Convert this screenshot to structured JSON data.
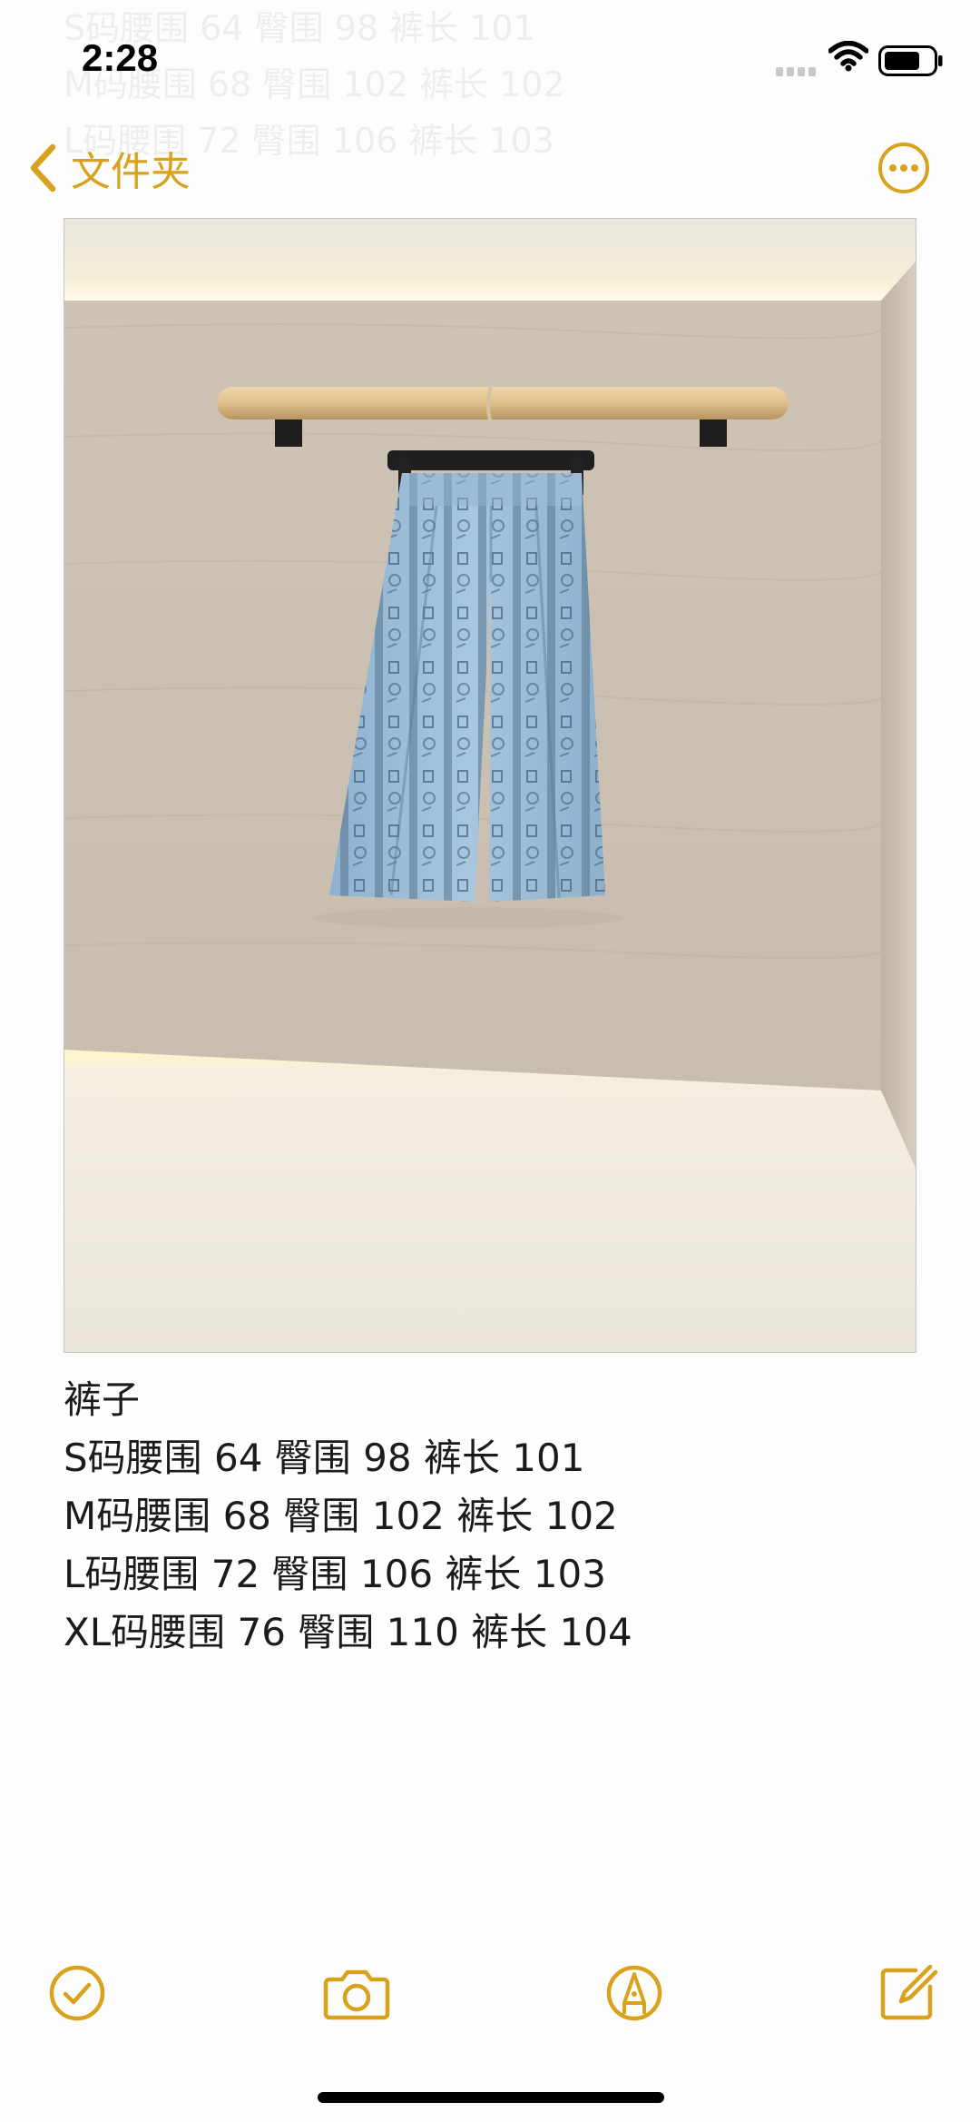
{
  "status_bar": {
    "time": "2:28",
    "icons": [
      "cellular-signal-icon",
      "wifi-icon",
      "battery-icon"
    ]
  },
  "nav": {
    "back_label": "文件夹",
    "back_icon": "chevron-left-icon",
    "more_icon": "ellipsis-circle-icon"
  },
  "note": {
    "image": "photo of light blue printed wide-leg trousers hanging on a wooden rail",
    "lines": [
      "裤子",
      "S码腰围 64 臀围 98 裤长 101",
      "M码腰围 68 臀围 102 裤长 102",
      "L码腰围 72 臀围 106 裤长 103",
      "XL码腰围 76 臀围 110 裤长 104"
    ]
  },
  "toolbar": {
    "items": [
      {
        "name": "checklist-button",
        "icon": "checkmark-circle-icon"
      },
      {
        "name": "camera-button",
        "icon": "camera-icon"
      },
      {
        "name": "markup-button",
        "icon": "pen-tip-circle-icon"
      },
      {
        "name": "compose-button",
        "icon": "compose-icon"
      }
    ]
  },
  "colors": {
    "accent": "#d9a21c",
    "background": "#fdfdfd",
    "text": "#1b1b1b"
  }
}
